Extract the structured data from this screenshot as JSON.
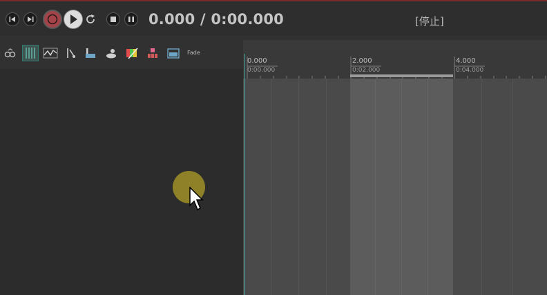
{
  "transport": {
    "time_display": "0.000 / 0:00.000",
    "status": "[停止]",
    "buttons": [
      {
        "name": "skip-to-start",
        "icon": "skip-back-icon"
      },
      {
        "name": "skip-to-end",
        "icon": "skip-forward-icon"
      },
      {
        "name": "record",
        "icon": "record-icon"
      },
      {
        "name": "play",
        "icon": "play-icon"
      },
      {
        "name": "loop",
        "icon": "loop-icon"
      },
      {
        "name": "stop",
        "icon": "stop-icon"
      },
      {
        "name": "pause",
        "icon": "pause-icon"
      }
    ]
  },
  "tools": {
    "items": [
      "link-icon",
      "grid-icon",
      "envelope-icon",
      "split-icon",
      "marker-icon",
      "duck-icon",
      "paint-icon",
      "tuning-icon",
      "clip-icon"
    ],
    "fade_label": "Fade"
  },
  "timeline": {
    "ruler": [
      {
        "label": "0.000",
        "sub": "0:00.000"
      },
      {
        "label": "2.000",
        "sub": "0:02.000"
      },
      {
        "label": "4.000",
        "sub": "0:04.000"
      }
    ]
  },
  "colors": {
    "accent": "#47c1b3",
    "record": "#a3444a",
    "selection": "#5c5c5c",
    "highlight": "#aa9a28"
  }
}
